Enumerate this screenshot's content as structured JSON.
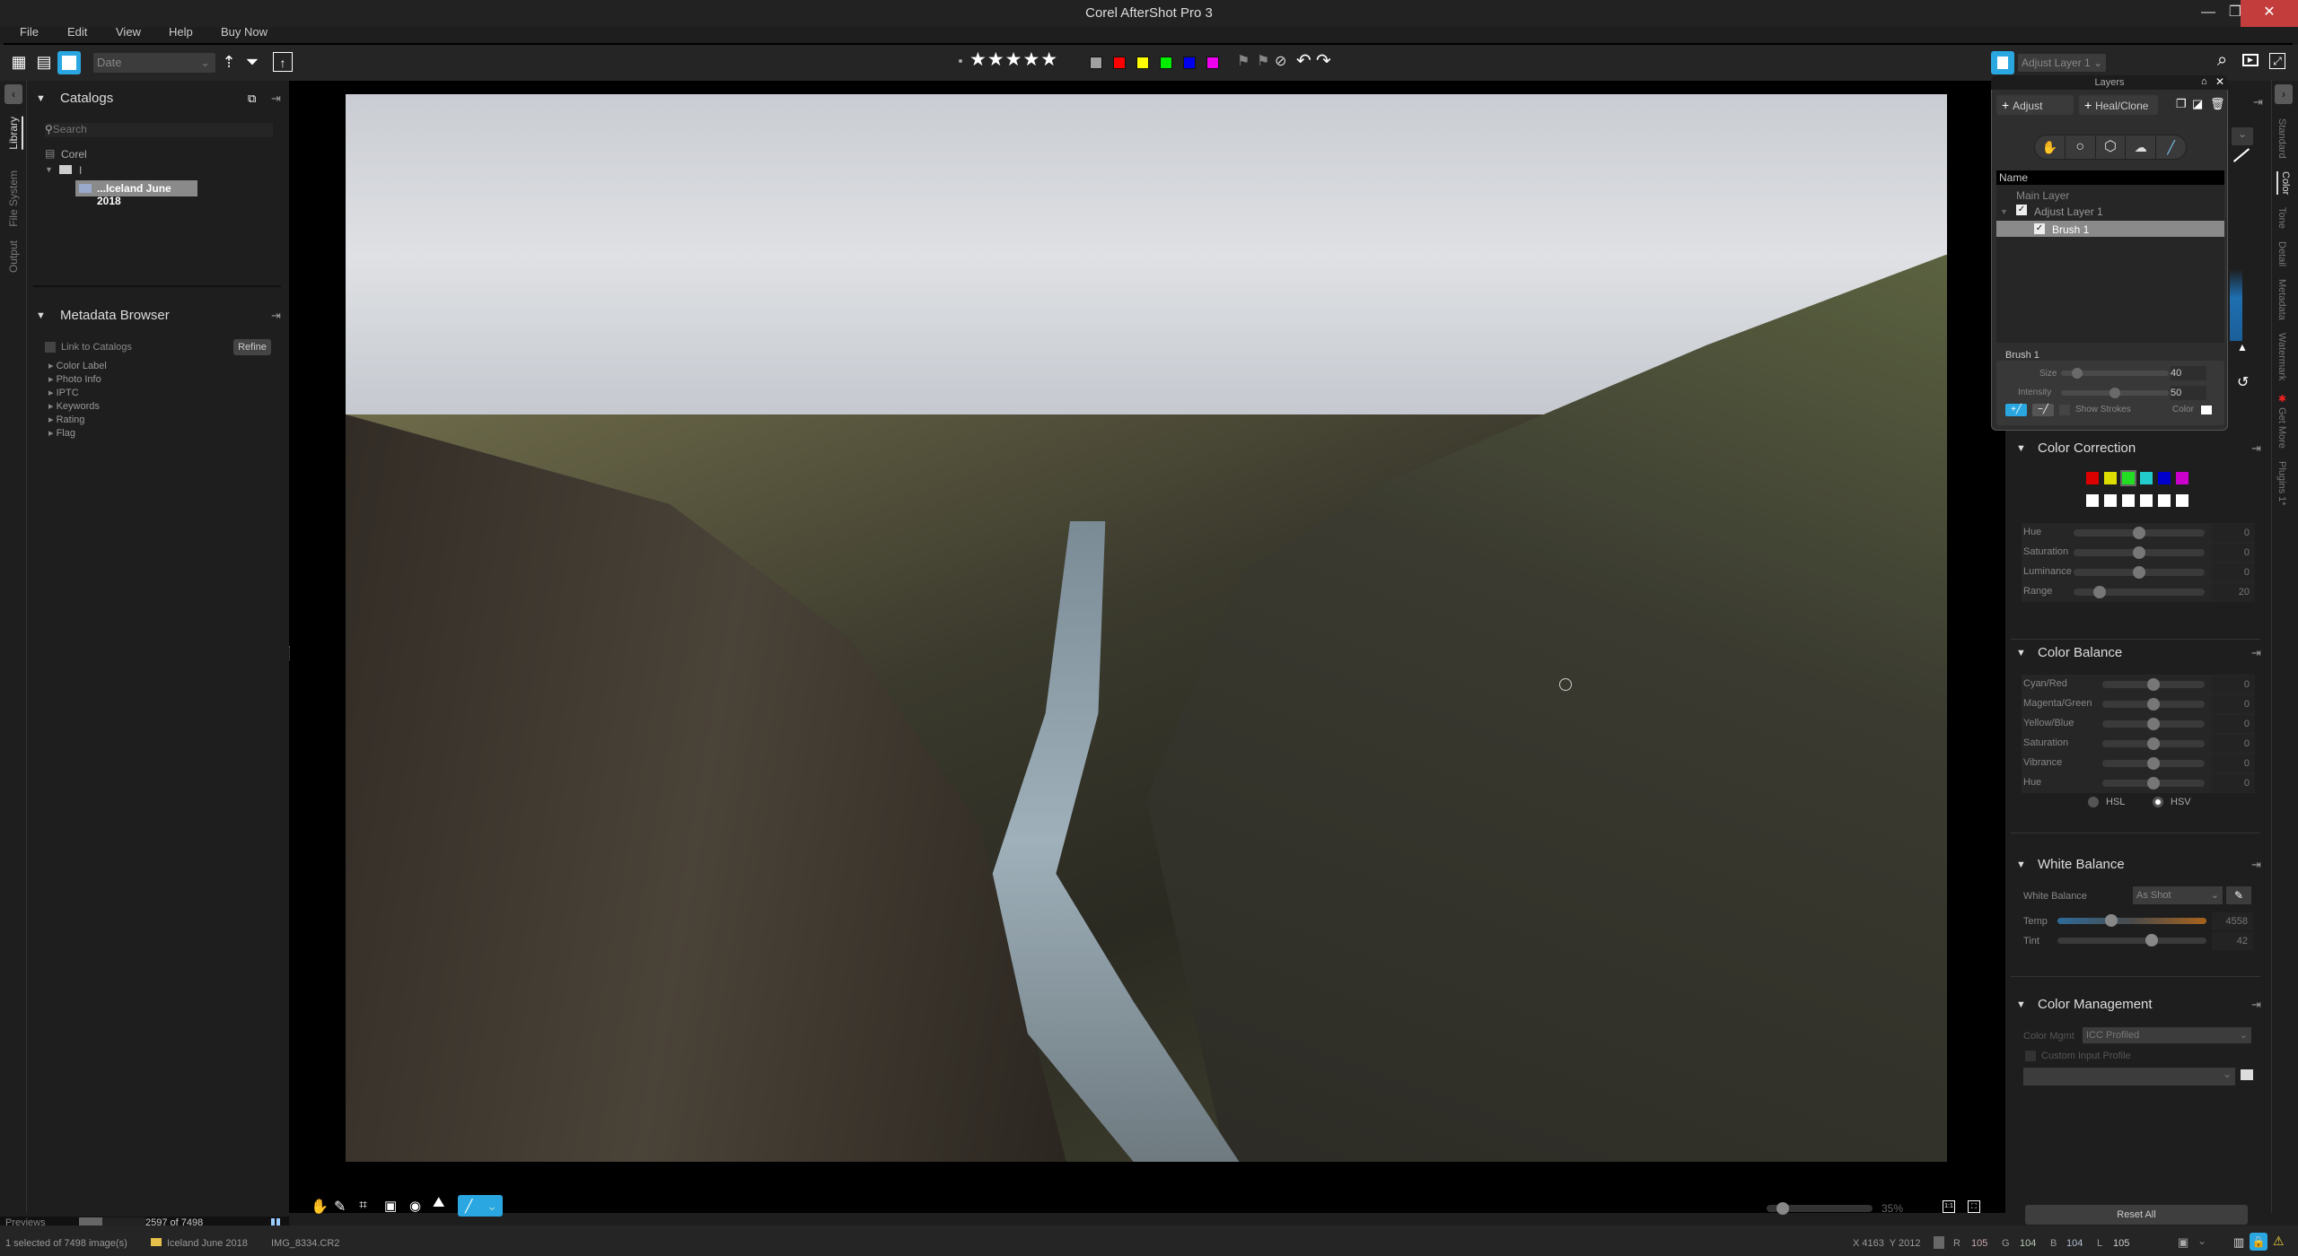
{
  "window": {
    "title": "Corel AfterShot Pro 3",
    "minimize": "—",
    "restore": "❐",
    "close": "✕"
  },
  "menu": [
    "File",
    "Edit",
    "View",
    "Help",
    "Buy Now"
  ],
  "toolbar": {
    "sort_value": "Date",
    "rating_stars": 5,
    "color_labels": [
      "#a0a0a0",
      "#ff0000",
      "#ffff00",
      "#00ee00",
      "#0000ee",
      "#ee00ee"
    ],
    "layer_select": "Adjust Layer 1"
  },
  "left_rail": {
    "tabs": [
      "Library",
      "File System",
      "Output"
    ],
    "active": "Library"
  },
  "catalogs": {
    "title": "Catalogs",
    "search_placeholder": "Search",
    "tree": [
      {
        "label": "Corel",
        "level": 0
      },
      {
        "label": "I",
        "level": 0
      },
      {
        "label": "...Iceland June 2018",
        "level": 1,
        "selected": true
      }
    ]
  },
  "metadata_browser": {
    "title": "Metadata Browser",
    "link_label": "Link to Catalogs",
    "refine": "Refine",
    "items": [
      "Color Label",
      "Photo Info",
      "IPTC",
      "Keywords",
      "Rating",
      "Flag"
    ]
  },
  "layers_panel": {
    "title": "Layers",
    "add_adjust": "Adjust",
    "add_heal": "Heal/Clone",
    "column_name": "Name",
    "rows": [
      {
        "label": "Main Layer",
        "checked": null,
        "level": 0
      },
      {
        "label": "Adjust Layer 1",
        "checked": true,
        "level": 0
      },
      {
        "label": "Brush 1",
        "checked": true,
        "level": 1,
        "selected": true
      }
    ],
    "brush": {
      "title": "Brush 1",
      "size_label": "Size",
      "size": 40,
      "intensity_label": "Intensity",
      "intensity": 50,
      "show_strokes": "Show Strokes",
      "color_label": "Color"
    }
  },
  "right_rail": {
    "tabs": [
      "Standard",
      "Color",
      "Tone",
      "Detail",
      "Metadata",
      "Watermark",
      "Get More",
      "Plugins 1*"
    ],
    "active": "Color"
  },
  "color_correction": {
    "title": "Color Correction",
    "swatches": [
      "#dd0000",
      "#dddd00",
      "#22dd22",
      "#22cccc",
      "#0000cc",
      "#cc00cc"
    ],
    "sliders": [
      {
        "label": "Hue",
        "value": "0",
        "pos": 0.5
      },
      {
        "label": "Saturation",
        "value": "0",
        "pos": 0.5
      },
      {
        "label": "Luminance",
        "value": "0",
        "pos": 0.5
      },
      {
        "label": "Range",
        "value": "20",
        "pos": 0.2
      }
    ]
  },
  "color_balance": {
    "title": "Color Balance",
    "sliders": [
      {
        "label": "Cyan/Red",
        "value": "0",
        "pos": 0.5
      },
      {
        "label": "Magenta/Green",
        "value": "0",
        "pos": 0.5
      },
      {
        "label": "Yellow/Blue",
        "value": "0",
        "pos": 0.5
      },
      {
        "label": "Saturation",
        "value": "0",
        "pos": 0.5
      },
      {
        "label": "Vibrance",
        "value": "0",
        "pos": 0.5
      },
      {
        "label": "Hue",
        "value": "0",
        "pos": 0.5
      }
    ],
    "mode_hsl": "HSL",
    "mode_hsv": "HSV",
    "mode_selected": "HSV"
  },
  "white_balance": {
    "title": "White Balance",
    "label": "White Balance",
    "value": "As Shot",
    "temp_label": "Temp",
    "temp": "4558",
    "temp_pos": 0.36,
    "tint_label": "Tint",
    "tint": "42",
    "tint_pos": 0.63
  },
  "color_management": {
    "title": "Color Management",
    "label": "Color Mgmt",
    "value": "ICC Profiled",
    "custom_profile": "Custom Input Profile"
  },
  "reset_all": "Reset All",
  "viewer": {
    "zoom": "35%",
    "zoom_pos": 0.15,
    "one_to_one": "1:1"
  },
  "previews": {
    "label": "Previews",
    "count": "2597 of 7498",
    "progress": 0.35
  },
  "status": {
    "selection": "1 selected of 7498 image(s)",
    "folder": "Iceland June 2018",
    "file": "IMG_8334.CR2",
    "coords": "X 4163  Y 2012",
    "r_label": "R",
    "r": "105",
    "g_label": "G",
    "g": "104",
    "b_label": "B",
    "b": "104",
    "l_label": "L",
    "l": "105"
  }
}
